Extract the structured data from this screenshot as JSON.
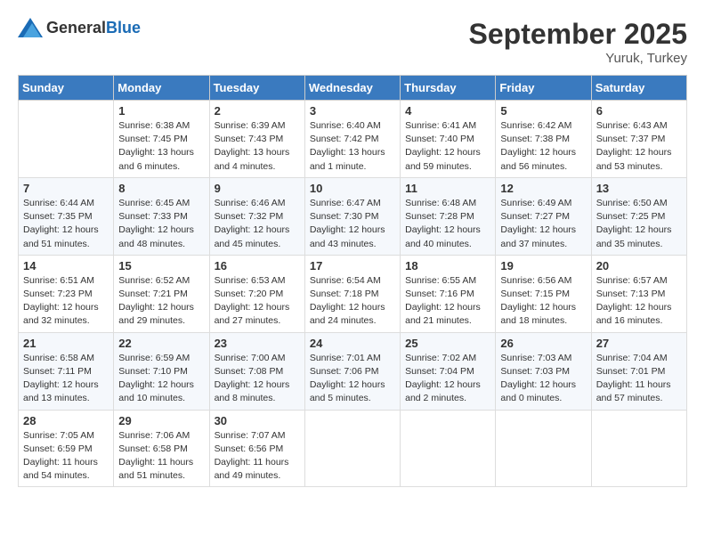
{
  "header": {
    "logo_general": "General",
    "logo_blue": "Blue",
    "month_year": "September 2025",
    "location": "Yuruk, Turkey"
  },
  "days_of_week": [
    "Sunday",
    "Monday",
    "Tuesday",
    "Wednesday",
    "Thursday",
    "Friday",
    "Saturday"
  ],
  "weeks": [
    [
      {
        "day": "",
        "info": ""
      },
      {
        "day": "1",
        "info": "Sunrise: 6:38 AM\nSunset: 7:45 PM\nDaylight: 13 hours\nand 6 minutes."
      },
      {
        "day": "2",
        "info": "Sunrise: 6:39 AM\nSunset: 7:43 PM\nDaylight: 13 hours\nand 4 minutes."
      },
      {
        "day": "3",
        "info": "Sunrise: 6:40 AM\nSunset: 7:42 PM\nDaylight: 13 hours\nand 1 minute."
      },
      {
        "day": "4",
        "info": "Sunrise: 6:41 AM\nSunset: 7:40 PM\nDaylight: 12 hours\nand 59 minutes."
      },
      {
        "day": "5",
        "info": "Sunrise: 6:42 AM\nSunset: 7:38 PM\nDaylight: 12 hours\nand 56 minutes."
      },
      {
        "day": "6",
        "info": "Sunrise: 6:43 AM\nSunset: 7:37 PM\nDaylight: 12 hours\nand 53 minutes."
      }
    ],
    [
      {
        "day": "7",
        "info": "Sunrise: 6:44 AM\nSunset: 7:35 PM\nDaylight: 12 hours\nand 51 minutes."
      },
      {
        "day": "8",
        "info": "Sunrise: 6:45 AM\nSunset: 7:33 PM\nDaylight: 12 hours\nand 48 minutes."
      },
      {
        "day": "9",
        "info": "Sunrise: 6:46 AM\nSunset: 7:32 PM\nDaylight: 12 hours\nand 45 minutes."
      },
      {
        "day": "10",
        "info": "Sunrise: 6:47 AM\nSunset: 7:30 PM\nDaylight: 12 hours\nand 43 minutes."
      },
      {
        "day": "11",
        "info": "Sunrise: 6:48 AM\nSunset: 7:28 PM\nDaylight: 12 hours\nand 40 minutes."
      },
      {
        "day": "12",
        "info": "Sunrise: 6:49 AM\nSunset: 7:27 PM\nDaylight: 12 hours\nand 37 minutes."
      },
      {
        "day": "13",
        "info": "Sunrise: 6:50 AM\nSunset: 7:25 PM\nDaylight: 12 hours\nand 35 minutes."
      }
    ],
    [
      {
        "day": "14",
        "info": "Sunrise: 6:51 AM\nSunset: 7:23 PM\nDaylight: 12 hours\nand 32 minutes."
      },
      {
        "day": "15",
        "info": "Sunrise: 6:52 AM\nSunset: 7:21 PM\nDaylight: 12 hours\nand 29 minutes."
      },
      {
        "day": "16",
        "info": "Sunrise: 6:53 AM\nSunset: 7:20 PM\nDaylight: 12 hours\nand 27 minutes."
      },
      {
        "day": "17",
        "info": "Sunrise: 6:54 AM\nSunset: 7:18 PM\nDaylight: 12 hours\nand 24 minutes."
      },
      {
        "day": "18",
        "info": "Sunrise: 6:55 AM\nSunset: 7:16 PM\nDaylight: 12 hours\nand 21 minutes."
      },
      {
        "day": "19",
        "info": "Sunrise: 6:56 AM\nSunset: 7:15 PM\nDaylight: 12 hours\nand 18 minutes."
      },
      {
        "day": "20",
        "info": "Sunrise: 6:57 AM\nSunset: 7:13 PM\nDaylight: 12 hours\nand 16 minutes."
      }
    ],
    [
      {
        "day": "21",
        "info": "Sunrise: 6:58 AM\nSunset: 7:11 PM\nDaylight: 12 hours\nand 13 minutes."
      },
      {
        "day": "22",
        "info": "Sunrise: 6:59 AM\nSunset: 7:10 PM\nDaylight: 12 hours\nand 10 minutes."
      },
      {
        "day": "23",
        "info": "Sunrise: 7:00 AM\nSunset: 7:08 PM\nDaylight: 12 hours\nand 8 minutes."
      },
      {
        "day": "24",
        "info": "Sunrise: 7:01 AM\nSunset: 7:06 PM\nDaylight: 12 hours\nand 5 minutes."
      },
      {
        "day": "25",
        "info": "Sunrise: 7:02 AM\nSunset: 7:04 PM\nDaylight: 12 hours\nand 2 minutes."
      },
      {
        "day": "26",
        "info": "Sunrise: 7:03 AM\nSunset: 7:03 PM\nDaylight: 12 hours\nand 0 minutes."
      },
      {
        "day": "27",
        "info": "Sunrise: 7:04 AM\nSunset: 7:01 PM\nDaylight: 11 hours\nand 57 minutes."
      }
    ],
    [
      {
        "day": "28",
        "info": "Sunrise: 7:05 AM\nSunset: 6:59 PM\nDaylight: 11 hours\nand 54 minutes."
      },
      {
        "day": "29",
        "info": "Sunrise: 7:06 AM\nSunset: 6:58 PM\nDaylight: 11 hours\nand 51 minutes."
      },
      {
        "day": "30",
        "info": "Sunrise: 7:07 AM\nSunset: 6:56 PM\nDaylight: 11 hours\nand 49 minutes."
      },
      {
        "day": "",
        "info": ""
      },
      {
        "day": "",
        "info": ""
      },
      {
        "day": "",
        "info": ""
      },
      {
        "day": "",
        "info": ""
      }
    ]
  ]
}
